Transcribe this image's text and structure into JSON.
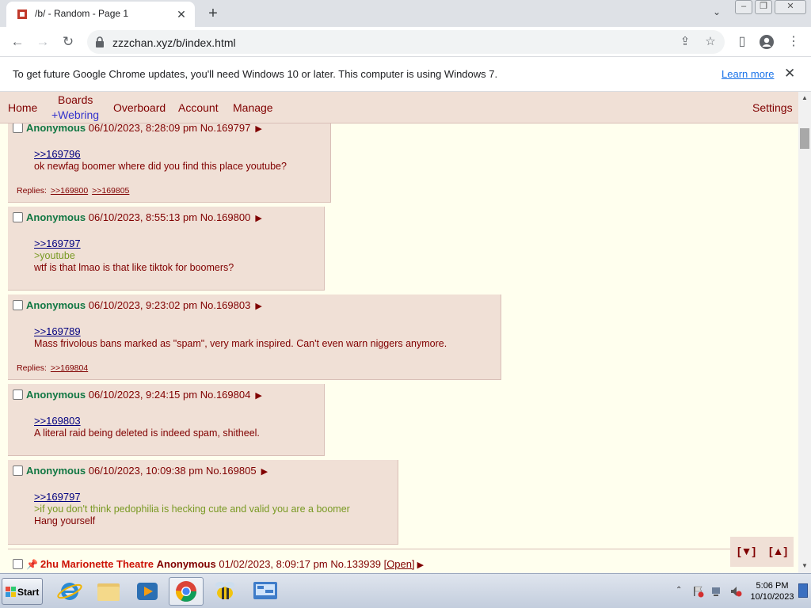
{
  "browser": {
    "tab_title": "/b/ - Random - Page 1",
    "tab_close": "✕",
    "new_tab": "+",
    "url": "zzzchan.xyz/b/index.html",
    "info_message": "To get future Google Chrome updates, you'll need Windows 10 or later. This computer is using Windows 7.",
    "info_link": "Learn more",
    "info_close": "✕"
  },
  "site_nav": {
    "home": "Home",
    "boards": "Boards",
    "webring": "+Webring",
    "overboard": "Overboard",
    "account": "Account",
    "manage": "Manage",
    "settings": "Settings"
  },
  "posts": [
    {
      "name": "Anonymous",
      "date": "06/10/2023, 8:28:09 pm",
      "number": "No.169797",
      "quote": ">>169796",
      "greentext": "",
      "text": "ok newfag boomer where did you find this place youtube?",
      "replies_label": "Replies:",
      "replies": [
        ">>169800",
        ">>169805"
      ]
    },
    {
      "name": "Anonymous",
      "date": "06/10/2023, 8:55:13 pm",
      "number": "No.169800",
      "quote": ">>169797",
      "greentext": ">youtube",
      "text": "wtf is that lmao is that like tiktok for boomers?"
    },
    {
      "name": "Anonymous",
      "date": "06/10/2023, 9:23:02 pm",
      "number": "No.169803",
      "quote": ">>169789",
      "greentext": "",
      "text": "Mass frivolous bans marked as \"spam\", very mark inspired. Can't even warn niggers anymore.",
      "replies_label": "Replies:",
      "replies": [
        ">>169804"
      ]
    },
    {
      "name": "Anonymous",
      "date": "06/10/2023, 9:24:15 pm",
      "number": "No.169804",
      "quote": ">>169803",
      "greentext": "",
      "text": "A literal raid being deleted is indeed spam, shitheel."
    },
    {
      "name": "Anonymous",
      "date": "06/10/2023, 10:09:38 pm",
      "number": "No.169805",
      "quote": ">>169797",
      "greentext": ">if you don't think pedophilia is hecking cute and valid you are a boomer",
      "text": "Hang yourself"
    }
  ],
  "jump": {
    "down": "[▼]",
    "up": "[▲]"
  },
  "next_thread": {
    "subject": "2hu Marionette Theatre",
    "name": "Anonymous",
    "date": "01/02/2023, 8:09:17 pm",
    "number": "No.133939",
    "open_label": "[Open]"
  },
  "taskbar": {
    "start_label": "Start",
    "time": "5:06 PM",
    "date": "10/10/2023"
  },
  "colors": {
    "board_bg": "#ffffee",
    "post_bg": "#f0e0d6",
    "name_green": "#117743",
    "maroon": "#800000",
    "quote_link": "#000080",
    "greentext": "#789922"
  }
}
